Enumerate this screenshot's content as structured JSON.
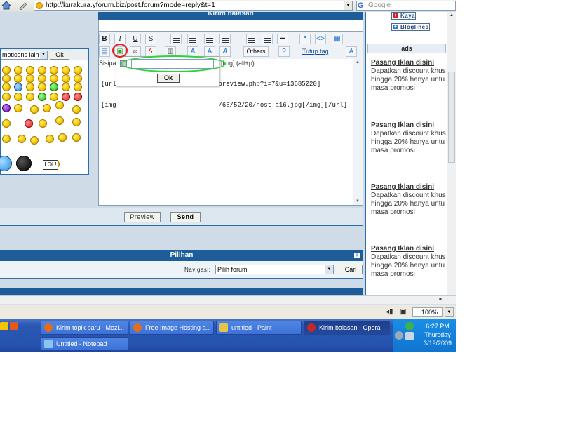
{
  "browser": {
    "url": "http://kurakura.yforum.biz/post.forum?mode=reply&t=1",
    "search_placeholder": "Google"
  },
  "reply_header": "Kirim balasan",
  "smiley_panel": {
    "select_value": "moticons lain",
    "ok_label": "Ok",
    "lol_label": "LOL!"
  },
  "editor": {
    "toolbar": {
      "bold": "B",
      "italic": "I",
      "underline": "U",
      "strike": "S",
      "others_label": "Others",
      "tutup_tag_label": "Tutup tag"
    },
    "sisip_label": "Sisipa",
    "alt_label": "[img] (alt+p)",
    "text_lines": [
      "[url=                          preview.php?i=7&u=13685220]",
      "[img                           /68/52/20/host_a16.jpg[/img][/url]"
    ]
  },
  "image_popup": {
    "input_value": "",
    "ok_label": "Ok"
  },
  "buttons": {
    "preview_label": "Preview",
    "send_label": "Send"
  },
  "pilihan": {
    "title": "Pilihan",
    "navigasi_label": "Navigasi:",
    "select_value": "Pilih forum",
    "cari_label": "Cari"
  },
  "sidebar": {
    "kaya_label": "Kaya",
    "bloglines_label": "Bloglines",
    "ads_title": "ads",
    "ads": [
      {
        "title": "Pasang Iklan disini",
        "lines": [
          "Dapatkan discount khus",
          "hingga 20% hanya untu",
          "masa promosi"
        ]
      },
      {
        "title": "Pasang Iklan disini",
        "lines": [
          "Dapatkan discount khus",
          "hingga 20% hanya untu",
          "masa promosi"
        ]
      },
      {
        "title": "Pasang Iklan disini",
        "lines": [
          "Dapatkan discount khus",
          "hingga 20% hanya untu",
          "masa promosi"
        ]
      },
      {
        "title": "Pasang Iklan disini",
        "lines": [
          "Dapatkan discount khus",
          "hingga 20% hanya untu",
          "masa promosi"
        ]
      }
    ]
  },
  "statusbar": {
    "zoom": "100%"
  },
  "taskbar": {
    "tasks": [
      {
        "label": "Kirim topik baru - Mozi...",
        "icon": "firefox-icon"
      },
      {
        "label": "Free Image Hosting a...",
        "icon": "firefox-icon"
      },
      {
        "label": "untitled - Paint",
        "icon": "paint-icon"
      },
      {
        "label": "Kirim balasan - Opera",
        "icon": "opera-icon"
      },
      {
        "label": "Untitled - Notepad",
        "icon": "notepad-icon"
      }
    ],
    "clock": {
      "time": "6:27 PM",
      "day": "Thursday",
      "date": "3/19/2009"
    }
  },
  "colors": {
    "forum_blue": "#1d5e9a",
    "highlight_red": "#e12020",
    "highlight_green": "#2ed23a",
    "taskbar_blue": "#2553ad"
  }
}
